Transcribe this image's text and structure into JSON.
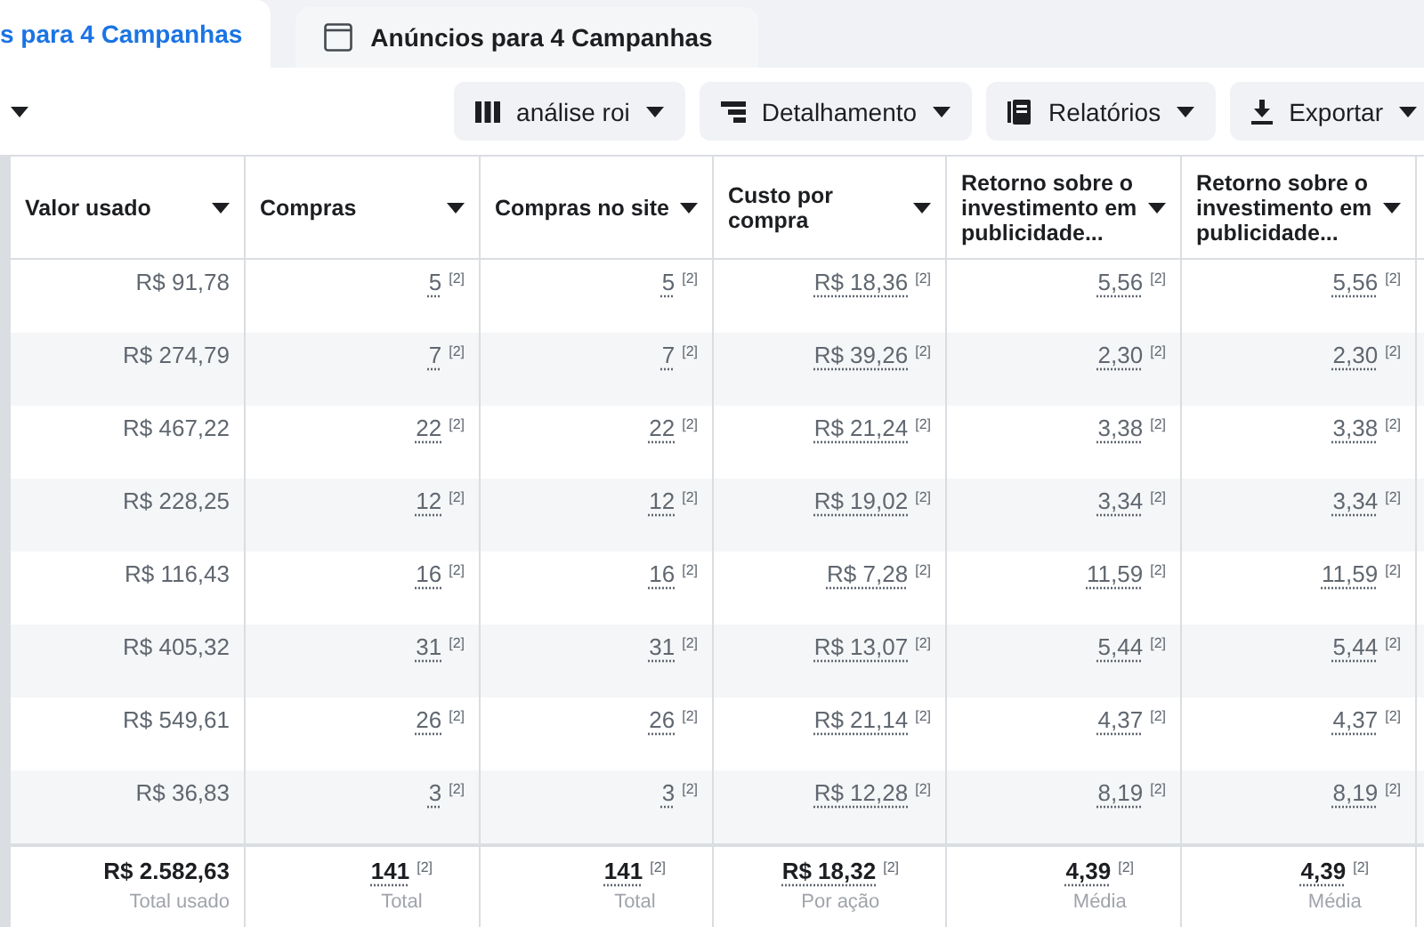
{
  "tabs": [
    {
      "label": "s para 4 Campanhas",
      "selected": true,
      "icon": false
    },
    {
      "label": "Anúncios para 4 Campanhas",
      "selected": false,
      "icon": true
    }
  ],
  "toolbar": {
    "buttons": [
      {
        "label": "análise roi",
        "kind": "columns"
      },
      {
        "label": "Detalhamento",
        "kind": "breakdown"
      },
      {
        "label": "Relatórios",
        "kind": "reports"
      },
      {
        "label": "Exportar",
        "kind": "export"
      }
    ]
  },
  "table": {
    "columns": [
      "Valor usado",
      "Compras",
      "Compras no site",
      "Custo por compra",
      "Retorno sobre o investimento em publicidade...",
      "Retorno sobre o investimento em publicidade..."
    ],
    "rows": [
      [
        {
          "value": "R$ 91,78"
        },
        {
          "value": "5",
          "note": "[2]"
        },
        {
          "value": "5",
          "note": "[2]"
        },
        {
          "value": "R$ 18,36",
          "note": "[2]"
        },
        {
          "value": "5,56",
          "note": "[2]"
        },
        {
          "value": "5,56",
          "note": "[2]"
        }
      ],
      [
        {
          "value": "R$ 274,79"
        },
        {
          "value": "7",
          "note": "[2]"
        },
        {
          "value": "7",
          "note": "[2]"
        },
        {
          "value": "R$ 39,26",
          "note": "[2]"
        },
        {
          "value": "2,30",
          "note": "[2]"
        },
        {
          "value": "2,30",
          "note": "[2]"
        }
      ],
      [
        {
          "value": "R$ 467,22"
        },
        {
          "value": "22",
          "note": "[2]"
        },
        {
          "value": "22",
          "note": "[2]"
        },
        {
          "value": "R$ 21,24",
          "note": "[2]"
        },
        {
          "value": "3,38",
          "note": "[2]"
        },
        {
          "value": "3,38",
          "note": "[2]"
        }
      ],
      [
        {
          "value": "R$ 228,25"
        },
        {
          "value": "12",
          "note": "[2]"
        },
        {
          "value": "12",
          "note": "[2]"
        },
        {
          "value": "R$ 19,02",
          "note": "[2]"
        },
        {
          "value": "3,34",
          "note": "[2]"
        },
        {
          "value": "3,34",
          "note": "[2]"
        }
      ],
      [
        {
          "value": "R$ 116,43"
        },
        {
          "value": "16",
          "note": "[2]"
        },
        {
          "value": "16",
          "note": "[2]"
        },
        {
          "value": "R$ 7,28",
          "note": "[2]"
        },
        {
          "value": "11,59",
          "note": "[2]"
        },
        {
          "value": "11,59",
          "note": "[2]"
        }
      ],
      [
        {
          "value": "R$ 405,32"
        },
        {
          "value": "31",
          "note": "[2]"
        },
        {
          "value": "31",
          "note": "[2]"
        },
        {
          "value": "R$ 13,07",
          "note": "[2]"
        },
        {
          "value": "5,44",
          "note": "[2]"
        },
        {
          "value": "5,44",
          "note": "[2]"
        }
      ],
      [
        {
          "value": "R$ 549,61"
        },
        {
          "value": "26",
          "note": "[2]"
        },
        {
          "value": "26",
          "note": "[2]"
        },
        {
          "value": "R$ 21,14",
          "note": "[2]"
        },
        {
          "value": "4,37",
          "note": "[2]"
        },
        {
          "value": "4,37",
          "note": "[2]"
        }
      ],
      [
        {
          "value": "R$ 36,83"
        },
        {
          "value": "3",
          "note": "[2]"
        },
        {
          "value": "3",
          "note": "[2]"
        },
        {
          "value": "R$ 12,28",
          "note": "[2]"
        },
        {
          "value": "8,19",
          "note": "[2]"
        },
        {
          "value": "8,19",
          "note": "[2]"
        }
      ]
    ],
    "totals": [
      {
        "value": "R$ 2.582,63",
        "caption": "Total usado"
      },
      {
        "value": "141",
        "note": "[2]",
        "caption": "Total"
      },
      {
        "value": "141",
        "note": "[2]",
        "caption": "Total"
      },
      {
        "value": "R$ 18,32",
        "note": "[2]",
        "caption": "Por ação"
      },
      {
        "value": "4,39",
        "note": "[2]",
        "caption": "Média"
      },
      {
        "value": "4,39",
        "note": "[2]",
        "caption": "Média"
      }
    ]
  }
}
